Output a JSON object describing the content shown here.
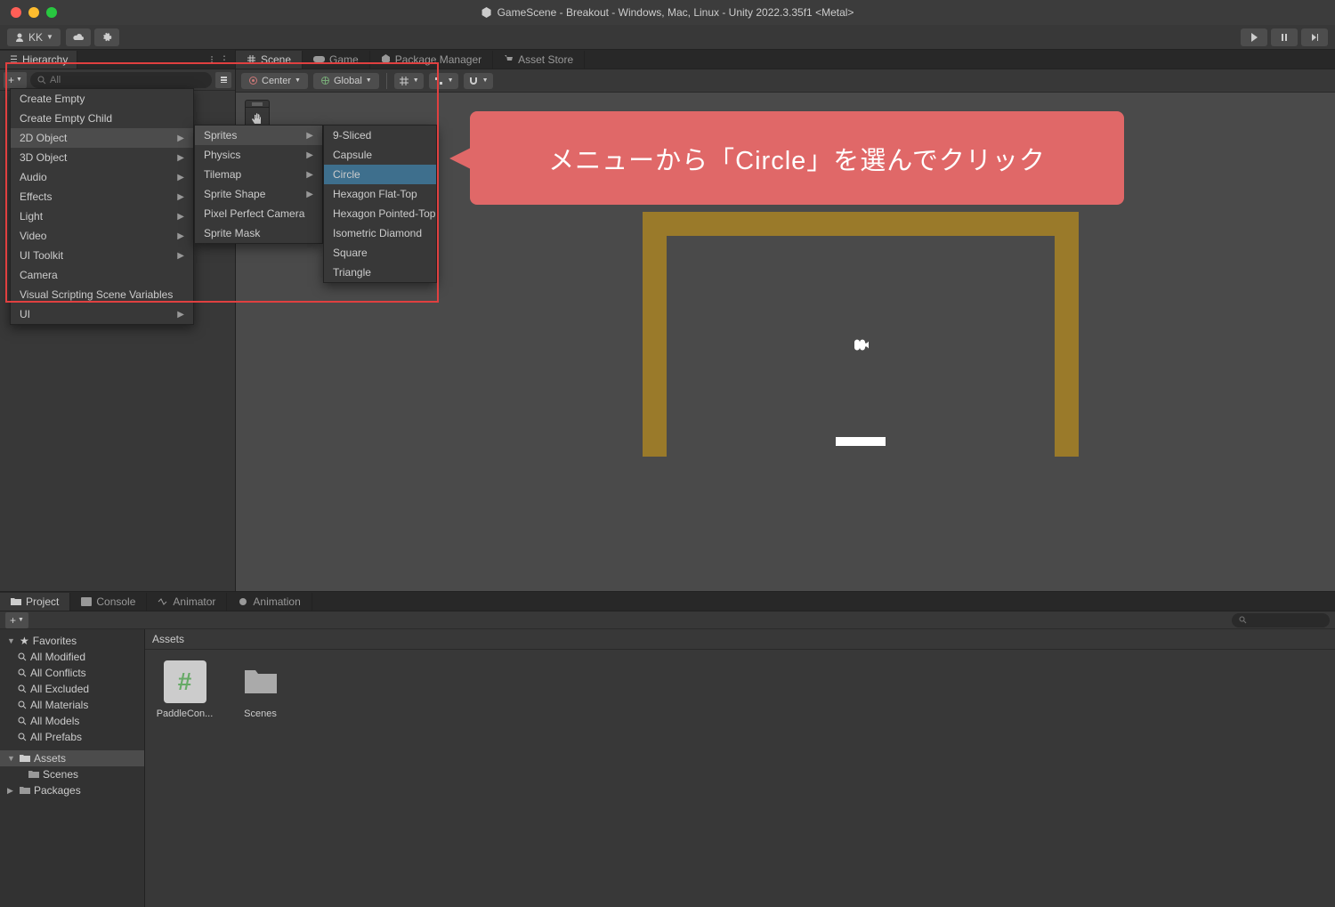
{
  "titlebar": {
    "title": "GameScene - Breakout - Windows, Mac, Linux - Unity 2022.3.35f1 <Metal>"
  },
  "toolbar": {
    "account_label": "KK"
  },
  "hierarchy": {
    "tab_label": "Hierarchy",
    "search_placeholder": "All"
  },
  "scene_tabs": {
    "scene": "Scene",
    "game": "Game",
    "package_manager": "Package Manager",
    "asset_store": "Asset Store"
  },
  "scene_toolbar": {
    "pivot": "Center",
    "handle": "Global"
  },
  "menu1": {
    "items": [
      {
        "label": "Create Empty",
        "arrow": false
      },
      {
        "label": "Create Empty Child",
        "arrow": false
      },
      {
        "label": "2D Object",
        "arrow": true,
        "highlight": true
      },
      {
        "label": "3D Object",
        "arrow": true
      },
      {
        "label": "Audio",
        "arrow": true
      },
      {
        "label": "Effects",
        "arrow": true
      },
      {
        "label": "Light",
        "arrow": true
      },
      {
        "label": "Video",
        "arrow": true
      },
      {
        "label": "UI Toolkit",
        "arrow": true
      },
      {
        "label": "Camera",
        "arrow": false
      },
      {
        "label": "Visual Scripting Scene Variables",
        "arrow": false
      },
      {
        "label": "UI",
        "arrow": true
      }
    ]
  },
  "menu2": {
    "items": [
      {
        "label": "Sprites",
        "arrow": true,
        "highlight": true
      },
      {
        "label": "Physics",
        "arrow": true
      },
      {
        "label": "Tilemap",
        "arrow": true
      },
      {
        "label": "Sprite Shape",
        "arrow": true
      },
      {
        "label": "Pixel Perfect Camera",
        "arrow": false
      },
      {
        "label": "Sprite Mask",
        "arrow": false
      }
    ]
  },
  "menu3": {
    "items": [
      {
        "label": "9-Sliced"
      },
      {
        "label": "Capsule"
      },
      {
        "label": "Circle",
        "selected": true
      },
      {
        "label": "Hexagon Flat-Top"
      },
      {
        "label": "Hexagon Pointed-Top"
      },
      {
        "label": "Isometric Diamond"
      },
      {
        "label": "Square"
      },
      {
        "label": "Triangle"
      }
    ]
  },
  "callout": {
    "text": "メニューから「Circle」を選んでクリック"
  },
  "bottom": {
    "tabs": {
      "project": "Project",
      "console": "Console",
      "animator": "Animator",
      "animation": "Animation"
    },
    "tree": {
      "favorites": "Favorites",
      "fav_items": [
        "All Modified",
        "All Conflicts",
        "All Excluded",
        "All Materials",
        "All Models",
        "All Prefabs"
      ],
      "assets": "Assets",
      "scenes": "Scenes",
      "packages": "Packages"
    },
    "breadcrumb": "Assets",
    "assets": [
      {
        "label": "PaddleCon...",
        "type": "script"
      },
      {
        "label": "Scenes",
        "type": "folder"
      }
    ]
  }
}
